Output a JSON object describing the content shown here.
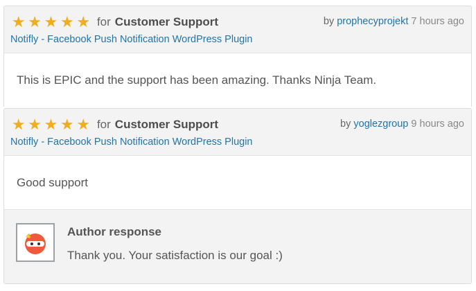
{
  "reviews": [
    {
      "rating": 5,
      "for_text": "for",
      "category": "Customer Support",
      "by_text": "by",
      "author": "prophecyprojekt",
      "time": "7 hours ago",
      "plugin": "Notifly - Facebook Push Notification WordPress Plugin",
      "body": "This is EPIC and the support has been amazing. Thanks Ninja Team."
    },
    {
      "rating": 5,
      "for_text": "for",
      "category": "Customer Support",
      "by_text": "by",
      "author": "yoglezgroup",
      "time": "9 hours ago",
      "plugin": "Notifly - Facebook Push Notification WordPress Plugin",
      "body": "Good support",
      "response": {
        "title": "Author response",
        "text": "Thank you. Your satisfaction is our goal :)",
        "avatar_icon": "ninja-avatar-icon"
      }
    }
  ],
  "colors": {
    "star": "#f0ad1c",
    "link": "#1f74a8",
    "header_bg": "#f3f3f3"
  }
}
